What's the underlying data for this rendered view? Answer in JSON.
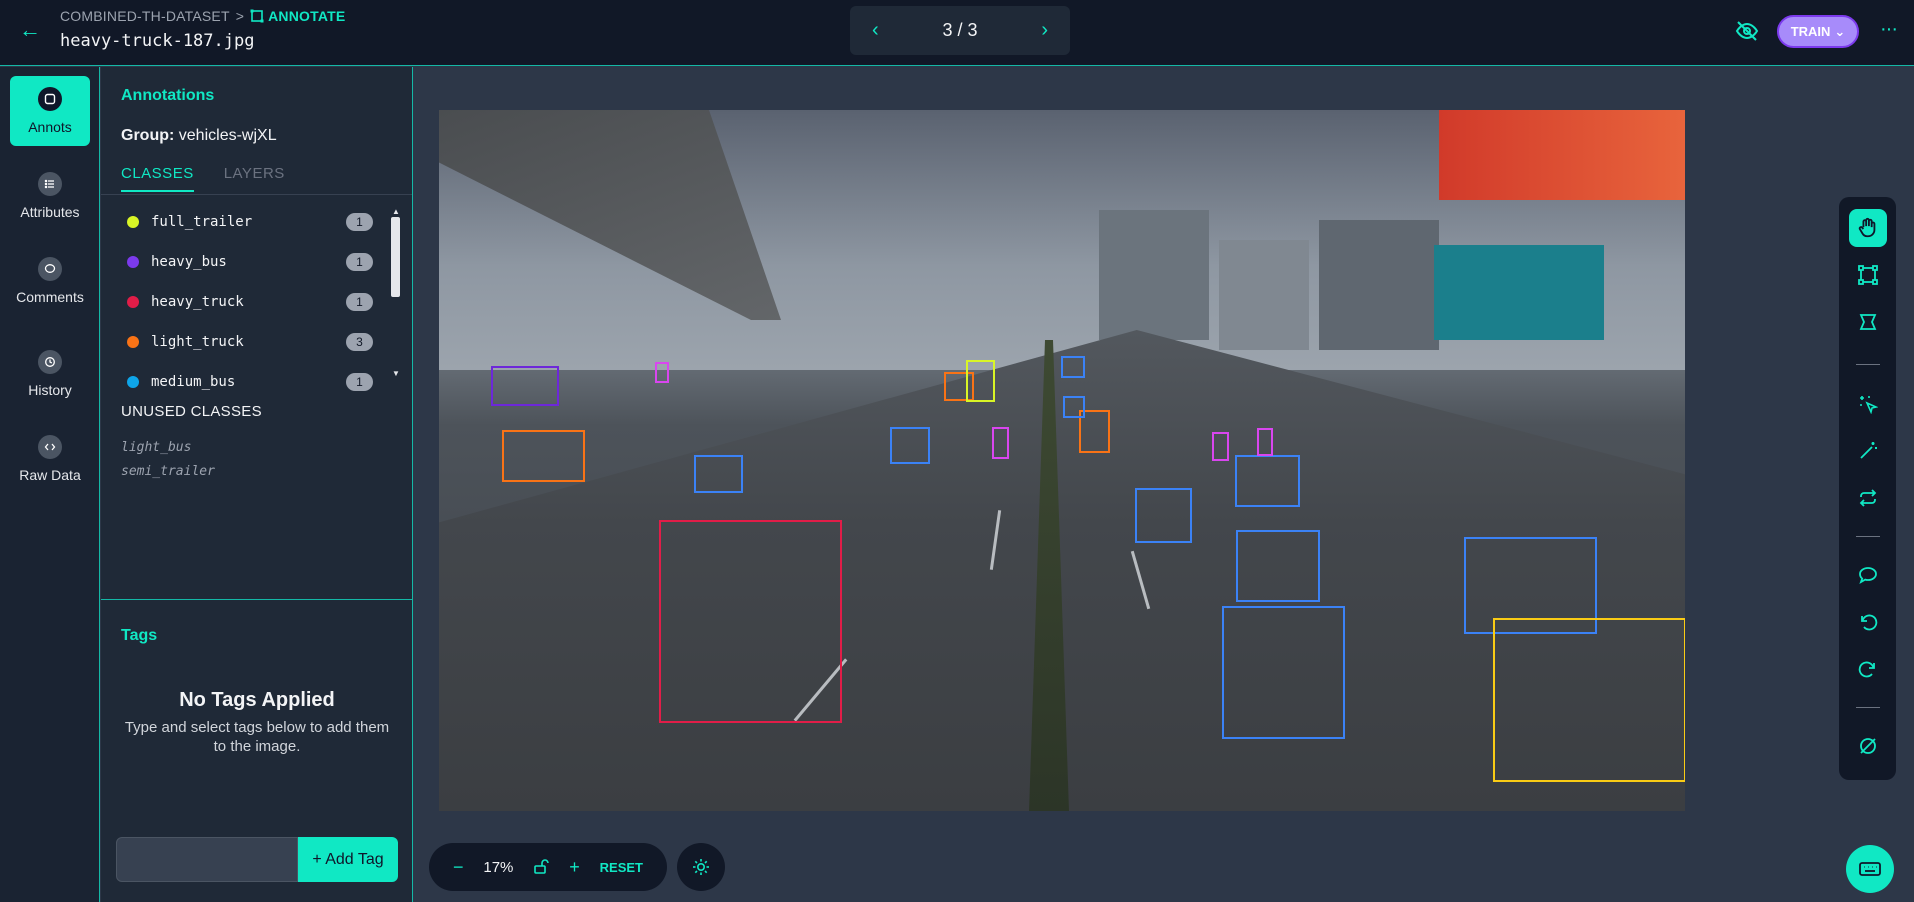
{
  "header": {
    "dataset": "COMBINED-TH-DATASET",
    "separator": ">",
    "mode": "ANNOTATE",
    "filename": "heavy-truck-187.jpg",
    "pager": "3 / 3",
    "train_label": "TRAIN",
    "more": "···"
  },
  "nav": {
    "annots": "Annots",
    "attributes": "Attributes",
    "comments": "Comments",
    "history": "History",
    "raw_data": "Raw Data"
  },
  "panel": {
    "title": "Annotations",
    "group_label": "Group:",
    "group_value": "vehicles-wjXL",
    "tabs": [
      "CLASSES",
      "LAYERS"
    ],
    "classes": [
      {
        "name": "full_trailer",
        "count": "1",
        "color": "#d9f526"
      },
      {
        "name": "heavy_bus",
        "count": "1",
        "color": "#7c3aed"
      },
      {
        "name": "heavy_truck",
        "count": "1",
        "color": "#e11d48"
      },
      {
        "name": "light_truck",
        "count": "3",
        "color": "#f97316"
      },
      {
        "name": "medium_bus",
        "count": "1",
        "color": "#0ea5e9"
      }
    ],
    "unused_title": "UNUSED CLASSES",
    "unused": [
      "light_bus",
      "semi_trailer"
    ]
  },
  "tags": {
    "title": "Tags",
    "empty_title": "No Tags Applied",
    "empty_text": "Type and select tags below to add them to the image.",
    "input_value": "",
    "add_label": "+ Add Tag"
  },
  "canvas": {
    "zoom": "17%",
    "reset_label": "RESET"
  },
  "colors": {
    "accent": "#10e8c4",
    "train": "#a78bfa",
    "car_box": "#3b82f6",
    "truck_box": "#e11d48",
    "trailer_box": "#facc15",
    "motorbike_box": "#d946ef",
    "light_truck_box": "#f97316"
  }
}
